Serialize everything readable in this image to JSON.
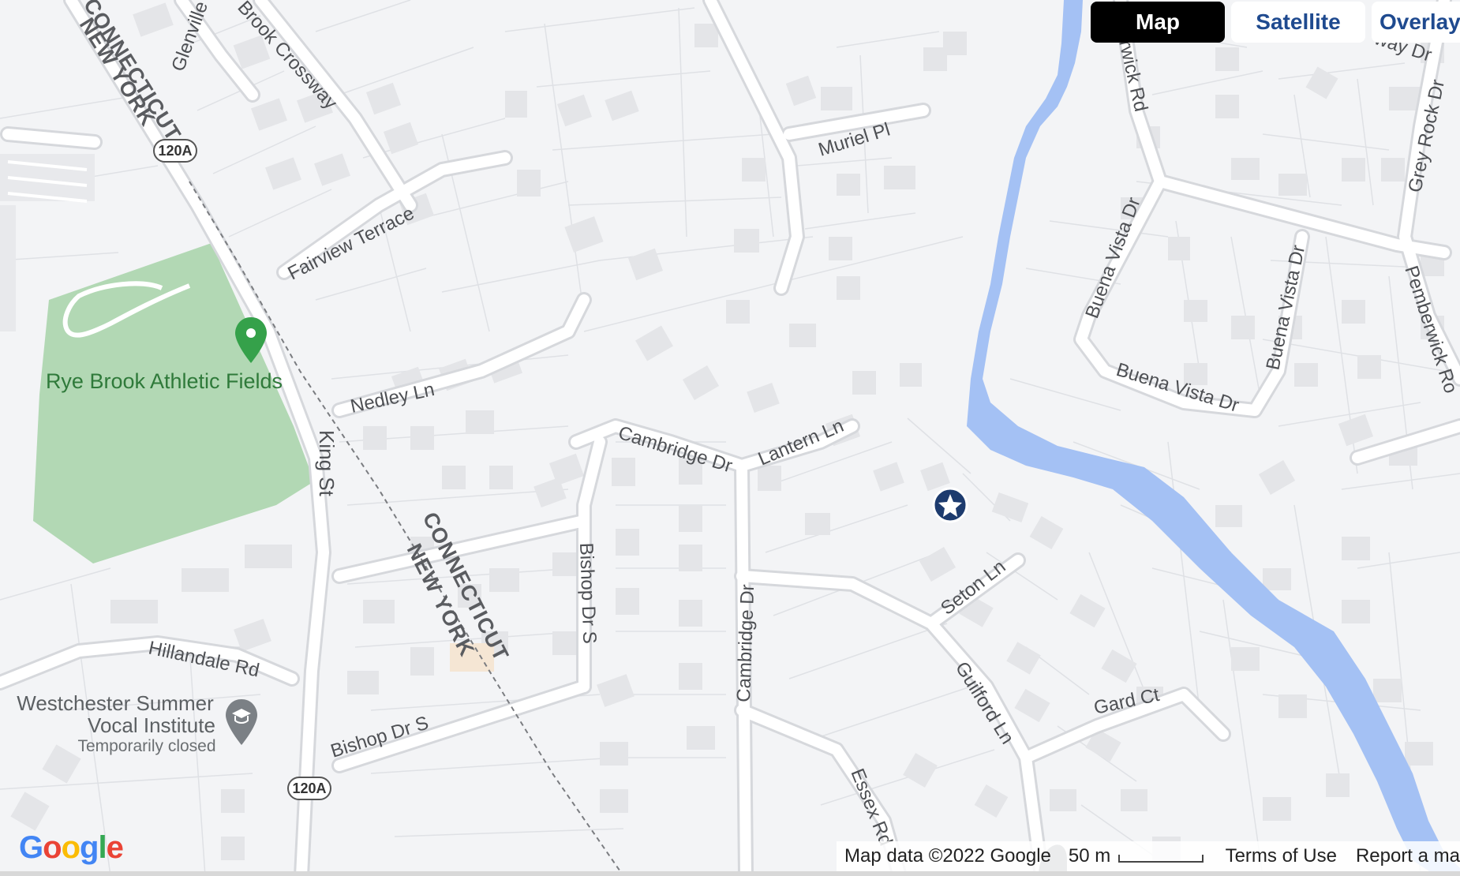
{
  "map_type_controls": {
    "map": "Map",
    "satellite": "Satellite",
    "overlays": "Overlays"
  },
  "roads": {
    "connecticut": "CONNECTICUT",
    "new_york": "NEW YORK",
    "glenville": "Glenville S",
    "brook_crossway": "Brook Crossway",
    "fairview_terrace": "Fairview Terrace",
    "nedley_ln": "Nedley Ln",
    "king_st": "King St",
    "hillandale_rd": "Hillandale Rd",
    "bishop_dr_s_1": "Bishop Dr S",
    "bishop_dr_s_2": "Bishop Dr S",
    "cambridge_dr_1": "Cambridge Dr",
    "cambridge_dr_2": "Cambridge Dr",
    "lantern_ln": "Lantern Ln",
    "muriel_pl": "Muriel Pl",
    "seton_ln": "Seton Ln",
    "guilford_ln": "Guilford Ln",
    "essex_rd": "Essex Rd",
    "gard_ct": "Gard Ct",
    "berwick_rd": "erwick Rd",
    "buena_vista_dr_1": "Buena Vista Dr",
    "buena_vista_dr_2": "Buena Vista Dr",
    "buena_vista_dr_3": "Buena Vista Dr",
    "grey_rock_dr": "Grey Rock Dr",
    "pemberwick_rd": "Pemberwick Ro",
    "way_dr": "way Dr",
    "route_120a": "120A"
  },
  "places": {
    "rye_brook_fields": "Rye Brook Athletic Fields",
    "westchester_line1": "Westchester Summer",
    "westchester_line2": "Vocal Institute",
    "westchester_status": "Temporarily closed"
  },
  "icons": {
    "green_pin": "park-pin-icon",
    "school": "school-icon",
    "star": "star-marker-icon"
  },
  "footer": {
    "copyright": "Map data ©2022 Google",
    "scale": "50 m",
    "terms": "Terms of Use",
    "report": "Report a ma"
  },
  "logo": "Google",
  "colors": {
    "map_background": "#f3f4f6",
    "water": "#a4c1f4",
    "park": "#b2d8b4",
    "road": "#ffffff",
    "active_control": "#000000",
    "control_text": "#1f4a8f",
    "marker": "#1d3b6e"
  }
}
